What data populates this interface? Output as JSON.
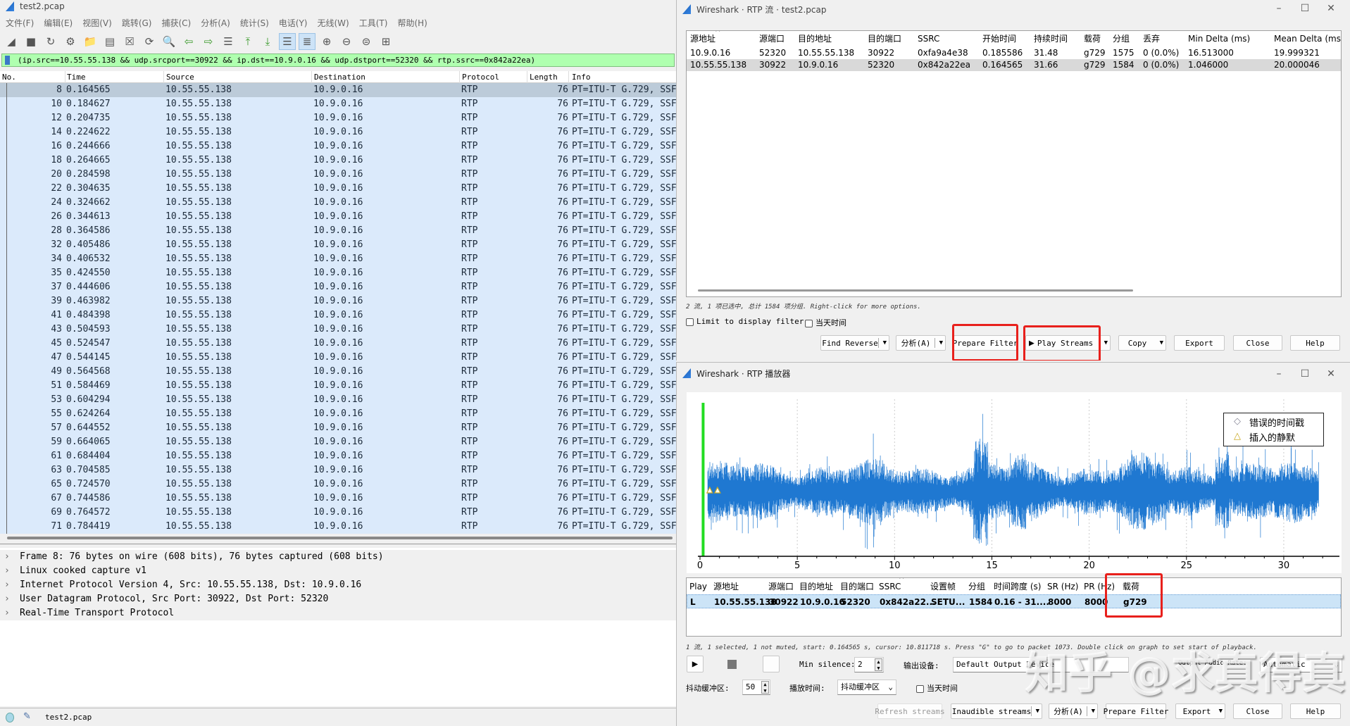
{
  "main": {
    "title": "test2.pcap",
    "menu": [
      "文件(F)",
      "编辑(E)",
      "视图(V)",
      "跳转(G)",
      "捕获(C)",
      "分析(A)",
      "统计(S)",
      "电话(Y)",
      "无线(W)",
      "工具(T)",
      "帮助(H)"
    ],
    "toolbar_icons": [
      "shark-fin-start-icon",
      "stop-capture-icon",
      "restart-capture-icon",
      "capture-options-icon",
      "open-file-icon",
      "save-file-icon",
      "close-file-icon",
      "reload-file-icon",
      "find-packet-icon",
      "go-back-icon",
      "go-forward-icon",
      "go-to-packet-icon",
      "go-first-icon",
      "go-last-icon",
      "autoscroll-icon",
      "colorize-icon",
      "zoom-in-icon",
      "zoom-out-icon",
      "normal-size-icon",
      "resize-columns-icon"
    ],
    "filter": "(ip.src==10.55.55.138 && udp.srcport==30922 && ip.dst==10.9.0.16 && udp.dstport==52320 && rtp.ssrc==0x842a22ea)",
    "columns": [
      "No.",
      "Time",
      "Source",
      "Destination",
      "Protocol",
      "Length",
      "Info"
    ],
    "packets": [
      [
        "8",
        "0.164565"
      ],
      [
        "10",
        "0.184627"
      ],
      [
        "12",
        "0.204735"
      ],
      [
        "14",
        "0.224622"
      ],
      [
        "16",
        "0.244666"
      ],
      [
        "18",
        "0.264665"
      ],
      [
        "20",
        "0.284598"
      ],
      [
        "22",
        "0.304635"
      ],
      [
        "24",
        "0.324662"
      ],
      [
        "26",
        "0.344613"
      ],
      [
        "28",
        "0.364586"
      ],
      [
        "32",
        "0.405486"
      ],
      [
        "34",
        "0.406532"
      ],
      [
        "35",
        "0.424550"
      ],
      [
        "37",
        "0.444606"
      ],
      [
        "39",
        "0.463982"
      ],
      [
        "41",
        "0.484398"
      ],
      [
        "43",
        "0.504593"
      ],
      [
        "45",
        "0.524547"
      ],
      [
        "47",
        "0.544145"
      ],
      [
        "49",
        "0.564568"
      ],
      [
        "51",
        "0.584469"
      ],
      [
        "53",
        "0.604294"
      ],
      [
        "55",
        "0.624264"
      ],
      [
        "57",
        "0.644552"
      ],
      [
        "59",
        "0.664065"
      ],
      [
        "61",
        "0.684404"
      ],
      [
        "63",
        "0.704585"
      ],
      [
        "65",
        "0.724570"
      ],
      [
        "67",
        "0.744586"
      ],
      [
        "69",
        "0.764572"
      ],
      [
        "71",
        "0.784419"
      ]
    ],
    "packet_common": {
      "source": "10.55.55.138",
      "destination": "10.9.0.16",
      "protocol": "RTP",
      "length": "76",
      "info": "PT=ITU-T G.729, SSF"
    },
    "selected_packet": "8",
    "details": [
      "Frame 8: 76 bytes on wire (608 bits), 76 bytes captured (608 bits)",
      "Linux cooked capture v1",
      "Internet Protocol Version 4, Src: 10.55.55.138, Dst: 10.9.0.16",
      "User Datagram Protocol, Src Port: 30922, Dst Port: 52320",
      "Real-Time Transport Protocol"
    ],
    "status_file": "test2.pcap"
  },
  "streams_dialog": {
    "title": "Wireshark · RTP 流 · test2.pcap",
    "columns": [
      "源地址",
      "源端口",
      "目的地址",
      "目的端口",
      "SSRC",
      "开始时间",
      "持续时间",
      "载荷",
      "分组",
      "丢弃",
      "Min Delta (ms)",
      "Mean Delta (ms)"
    ],
    "rows": [
      [
        "10.9.0.16",
        "52320",
        "10.55.55.138",
        "30922",
        "0xfa9a4e38",
        "0.185586",
        "31.48",
        "g729",
        "1575",
        "0 (0.0%)",
        "16.513000",
        "19.999321"
      ],
      [
        "10.55.55.138",
        "30922",
        "10.9.0.16",
        "52320",
        "0x842a22ea",
        "0.164565",
        "31.66",
        "g729",
        "1584",
        "0 (0.0%)",
        "1.046000",
        "20.000046"
      ]
    ],
    "status": "2 流, 1 项已选中, 总计 1584 项分组. Right-click for more options.",
    "limit_filter": "Limit to display filter",
    "time_of_day": "当天时间",
    "buttons": {
      "find_reverse": "Find Reverse",
      "analyze": "分析(A)",
      "prepare_filter": "Prepare Filter",
      "play_streams": "Play Streams",
      "copy": "Copy",
      "export": "Export",
      "close": "Close",
      "help": "Help"
    }
  },
  "player_dialog": {
    "title": "Wireshark · RTP 播放器",
    "legend": [
      "错误的时间戳",
      "插入的静默"
    ],
    "x_ticks": [
      "0",
      "5",
      "10",
      "15",
      "20",
      "25",
      "30"
    ],
    "x_range": [
      0,
      32.5
    ],
    "cursor_time": 0.16,
    "waveform_color": "#1f78d1",
    "cursor_color": "#22dd22",
    "silence_markers": [
      0.5,
      0.9
    ],
    "columns": [
      "Play",
      "源地址",
      "源端口",
      "目的地址",
      "目的端口",
      "SSRC",
      "设置帧",
      "分组",
      "时间跨度 (s)",
      "SR (Hz)",
      "PR (Hz)",
      "载荷"
    ],
    "row": [
      "L",
      "10.55.55.138",
      "30922",
      "10.9.0.16",
      "52320",
      "0x842a22...",
      "SETU...",
      "1584",
      "0.16 - 31....",
      "8000",
      "8000",
      "g729"
    ],
    "status": "1 流, 1 selected, 1 not muted, start: 0.164565 s, cursor: 10.811718 s. Press \"G\" to go to packet 1073. Double click on graph to set start of playback.",
    "min_silence_label": "Min silence:",
    "min_silence": "2",
    "output_device_label": "输出设备:",
    "output_device": "Default Output Device",
    "output_rate_label": "Output Audio Rate:",
    "output_rate": "Automatic",
    "jitter_label": "抖动缓冲区:",
    "jitter": "50",
    "playback_label": "播放时间:",
    "playback": "抖动缓冲区",
    "time_of_day": "当天时间",
    "buttons": {
      "refresh": "Refresh streams",
      "inaudible": "Inaudible streams",
      "analyze": "分析(A)",
      "prepare_filter": "Prepare Filter",
      "export": "Export",
      "close": "Close",
      "help": "Help"
    }
  },
  "watermark": "知乎 @求真得真"
}
